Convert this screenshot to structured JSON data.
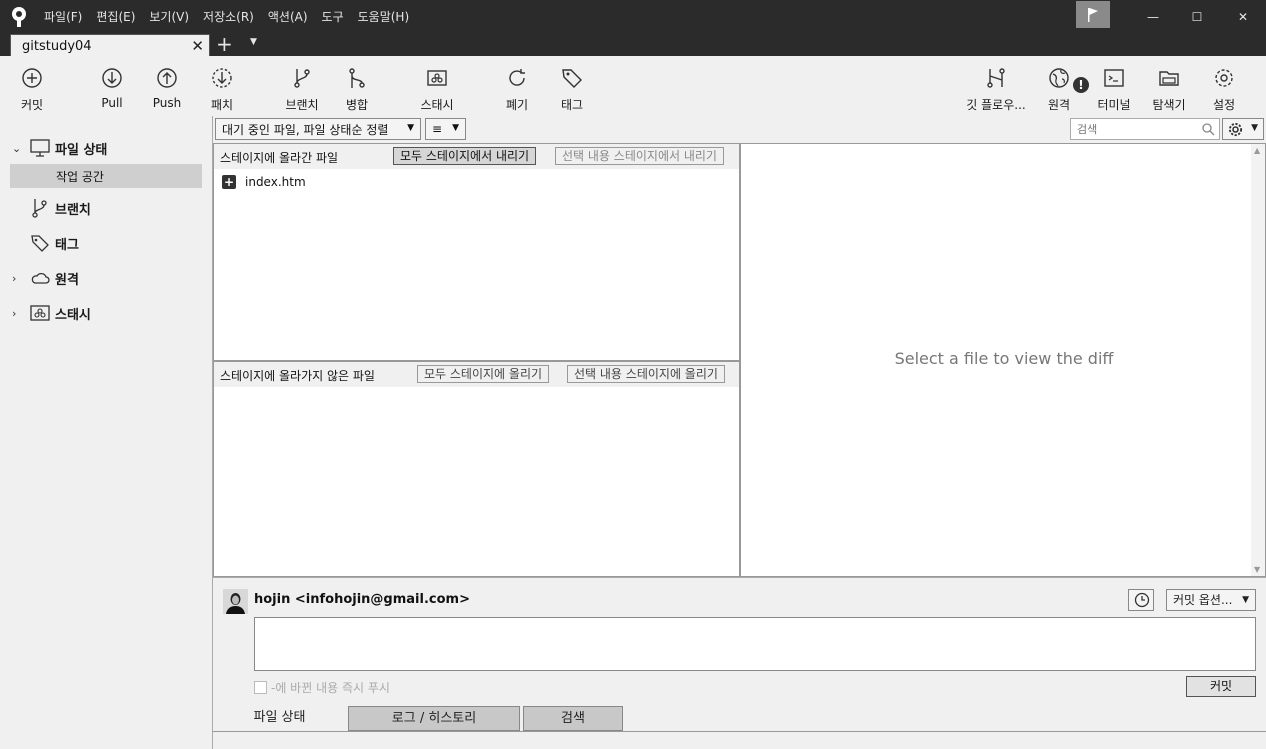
{
  "menu": [
    "파일(F)",
    "편집(E)",
    "보기(V)",
    "저장소(R)",
    "액션(A)",
    "도구",
    "도움말(H)"
  ],
  "tab": {
    "title": "gitstudy04",
    "close": "✕",
    "add": "+"
  },
  "window": {
    "minimize": "—",
    "maximize": "☐",
    "close": "✕"
  },
  "toolbar": {
    "commit": "커밋",
    "pull": "Pull",
    "push": "Push",
    "fetch": "패치",
    "branch": "브랜치",
    "merge": "병합",
    "stash": "스태시",
    "discard": "폐기",
    "tag": "태그",
    "gitflow": "깃 플로우...",
    "remote": "원격",
    "terminal": "터미널",
    "explorer": "탐색기",
    "settings": "설정",
    "remote_badge": "!"
  },
  "sidebar": {
    "file_status": "파일 상태",
    "workspace": "작업 공간",
    "branches": "브랜치",
    "tags": "태그",
    "remotes": "원격",
    "stashes": "스태시"
  },
  "filter": {
    "sort_label": "대기 중인 파일, 파일 상태순 정렬",
    "view_icon": "≡",
    "search_placeholder": "검색"
  },
  "staged": {
    "title": "스테이지에 올라간 파일",
    "unstage_all": "모두 스테이지에서 내리기",
    "unstage_selected": "선택 내용 스테이지에서 내리기",
    "files": [
      {
        "name": "index.htm",
        "status": "added"
      }
    ]
  },
  "unstaged": {
    "title": "스테이지에 올라가지 않은 파일",
    "stage_all": "모두 스테이지에 올리기",
    "stage_selected": "선택 내용 스테이지에 올리기"
  },
  "diff": {
    "placeholder": "Select a file to view the diff"
  },
  "commit": {
    "author": "hojin <infohojin@gmail.com>",
    "options": "커밋 옵션...",
    "push_immediately": "-에 바뀐 내용 즉시 푸시",
    "button": "커밋"
  },
  "bottom_tabs": {
    "file_status": "파일 상태",
    "log": "로그 / 히스토리",
    "search": "검색"
  }
}
